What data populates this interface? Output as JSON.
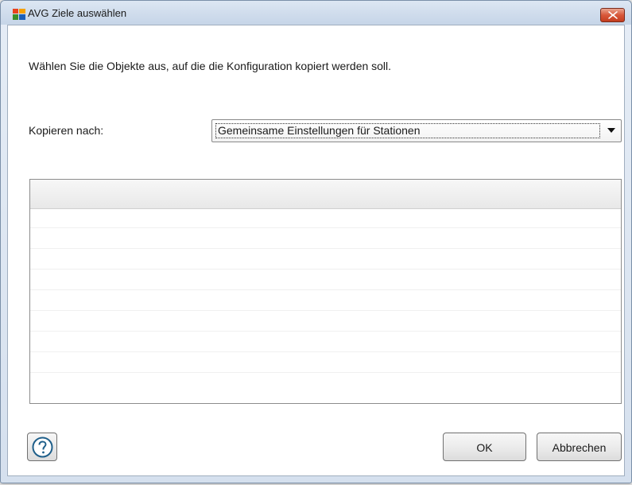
{
  "window": {
    "title": "AVG Ziele auswählen",
    "app_icon": "avg-logo-icon",
    "close_icon": "close-icon"
  },
  "instruction": "Wählen Sie die Objekte aus, auf die die Konfiguration kopiert werden soll.",
  "copy_to": {
    "label": "Kopieren nach:",
    "selected": "Gemeinsame Einstellungen für Stationen"
  },
  "targets_list": {
    "items": []
  },
  "buttons": {
    "help_icon": "help-icon",
    "ok": "OK",
    "cancel": "Abbrechen"
  },
  "colors": {
    "close_button": "#d8583a",
    "title_bar": "#cfdcec"
  }
}
